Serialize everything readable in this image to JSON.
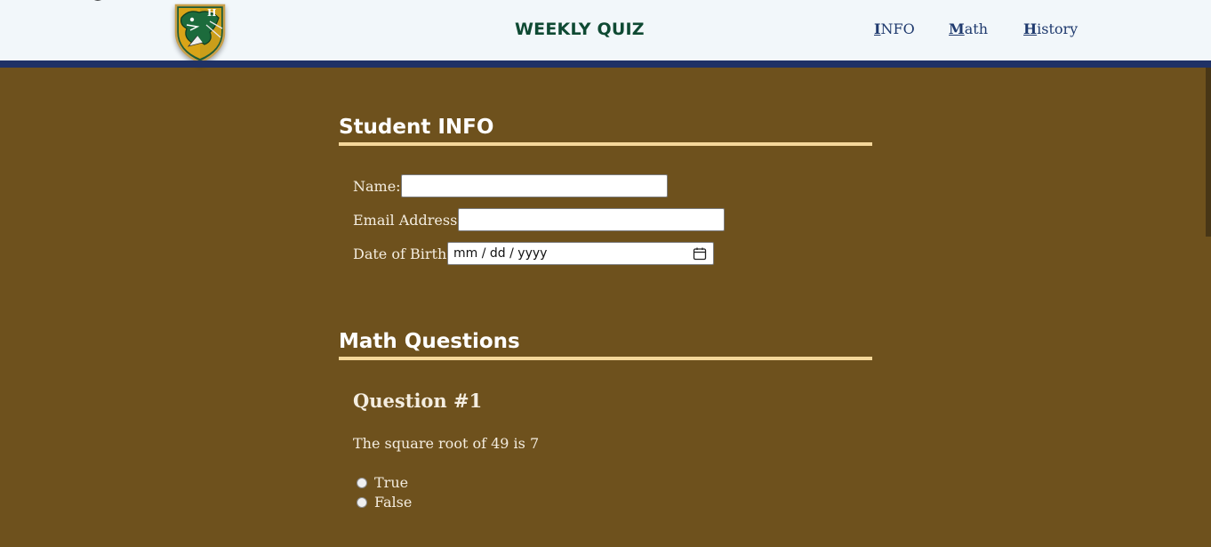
{
  "header": {
    "title": "WEEKLY QUIZ",
    "nav": [
      {
        "key": "I",
        "rest": "NFO"
      },
      {
        "key": "M",
        "rest": "ath"
      },
      {
        "key": "H",
        "rest": "istory"
      }
    ],
    "logo_icon": "school-shield-logo",
    "logo_letter": "H",
    "colors": {
      "header_bg": "#f2f7fa",
      "bar": "#1f3166",
      "title": "#0f4a33",
      "nav": "#1f3a6e"
    }
  },
  "page": {
    "background": "#6e511d",
    "rule_color": "#f5d79a"
  },
  "student_info": {
    "heading": "Student INFO",
    "name_label": "Name:",
    "name_value": "",
    "email_label": "Email Address:",
    "email_value": "",
    "dob_label": "Date of Birth:",
    "dob_placeholder": "mm / dd / yyyy",
    "dob_icon": "calendar-icon"
  },
  "math": {
    "heading": "Math Questions",
    "questions": [
      {
        "title": "Question #1",
        "text": "The square root of 49 is 7",
        "options": [
          "True",
          "False"
        ],
        "selected": null
      }
    ]
  }
}
